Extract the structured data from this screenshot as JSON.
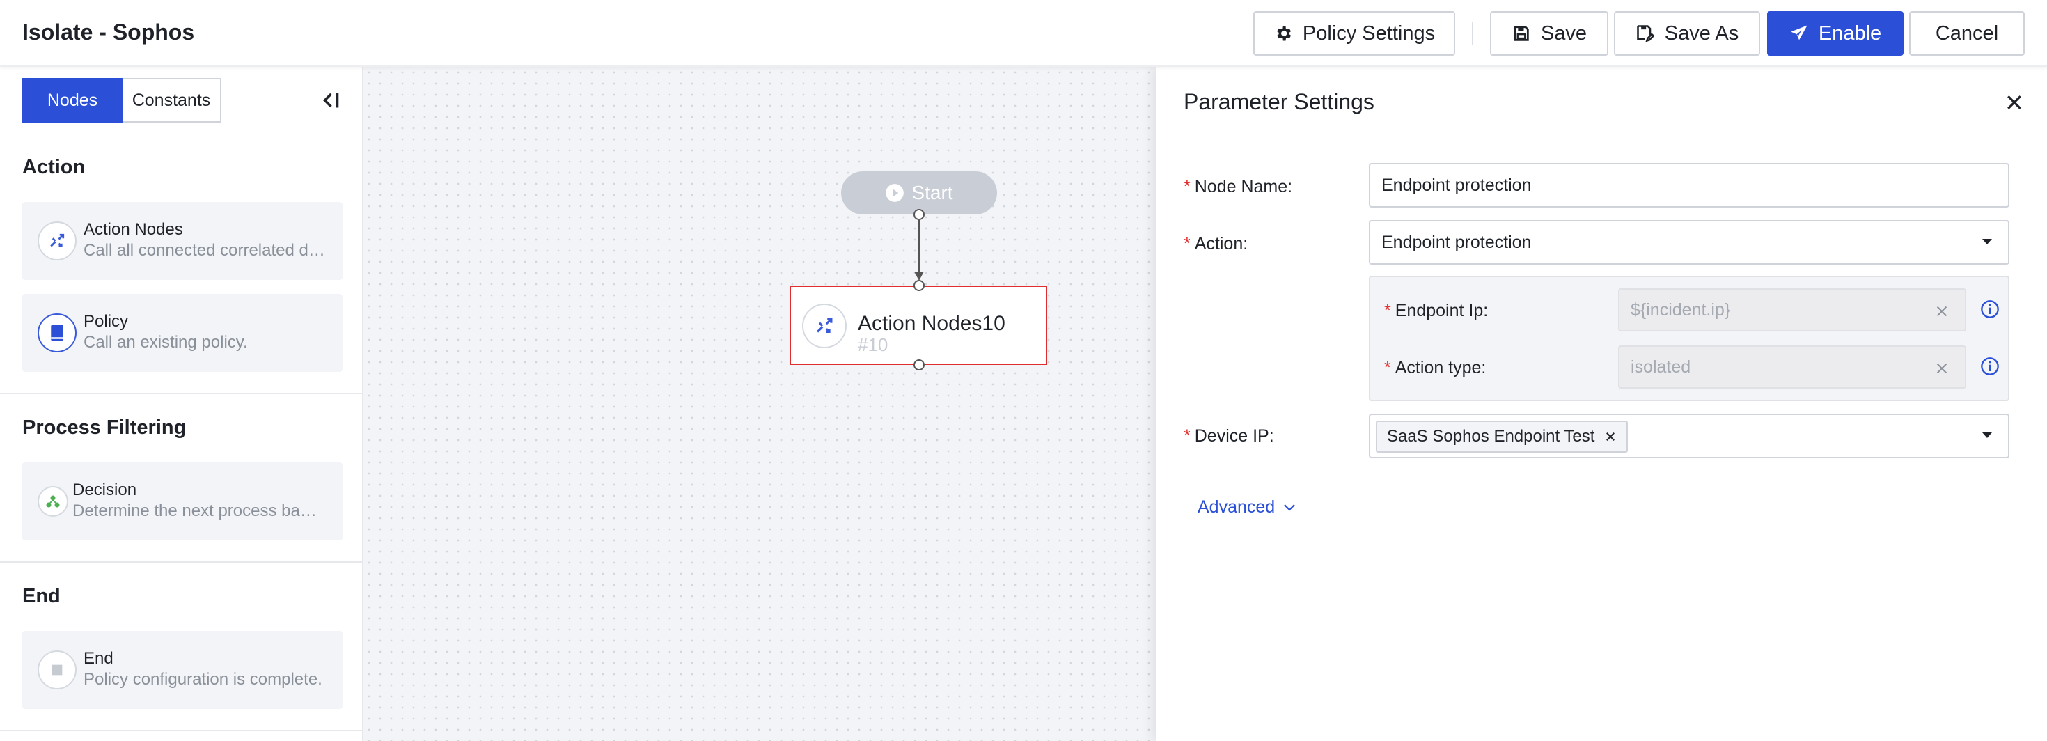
{
  "header": {
    "title": "Isolate - Sophos",
    "policy_settings": "Policy Settings",
    "save": "Save",
    "save_as": "Save As",
    "enable": "Enable",
    "cancel": "Cancel"
  },
  "sidebar": {
    "tabs": [
      "Nodes",
      "Constants"
    ],
    "active_tab": "Nodes",
    "sections": [
      {
        "title": "Action",
        "items": [
          {
            "name": "Action Nodes",
            "desc": "Call all connected correlated devices",
            "icon": "action-nodes-icon"
          },
          {
            "name": "Policy",
            "desc": "Call an existing policy.",
            "icon": "book-icon"
          }
        ]
      },
      {
        "title": "Process Filtering",
        "items": [
          {
            "name": "Decision",
            "desc": "Determine the next process based on conditions",
            "icon": "decision-icon"
          }
        ]
      },
      {
        "title": "End",
        "items": [
          {
            "name": "End",
            "desc": "Policy configuration is complete.",
            "icon": "stop-icon"
          }
        ]
      }
    ]
  },
  "canvas": {
    "start_label": "Start",
    "node": {
      "name": "Action Nodes10",
      "id": "#10"
    }
  },
  "panel": {
    "title": "Parameter Settings",
    "node_name_label": "Node Name:",
    "node_name_value": "Endpoint protection",
    "action_label": "Action:",
    "action_value": "Endpoint protection",
    "endpoint_ip_label": "Endpoint Ip:",
    "endpoint_ip_placeholder": "${incident.ip}",
    "action_type_label": "Action type:",
    "action_type_placeholder": "isolated",
    "device_ip_label": "Device IP:",
    "device_ip_tag": "SaaS Sophos Endpoint Test",
    "advanced_label": "Advanced",
    "required_mark": "*"
  },
  "colors": {
    "primary": "#2b50d7",
    "danger": "#e02e2e",
    "muted": "#8a9099"
  }
}
